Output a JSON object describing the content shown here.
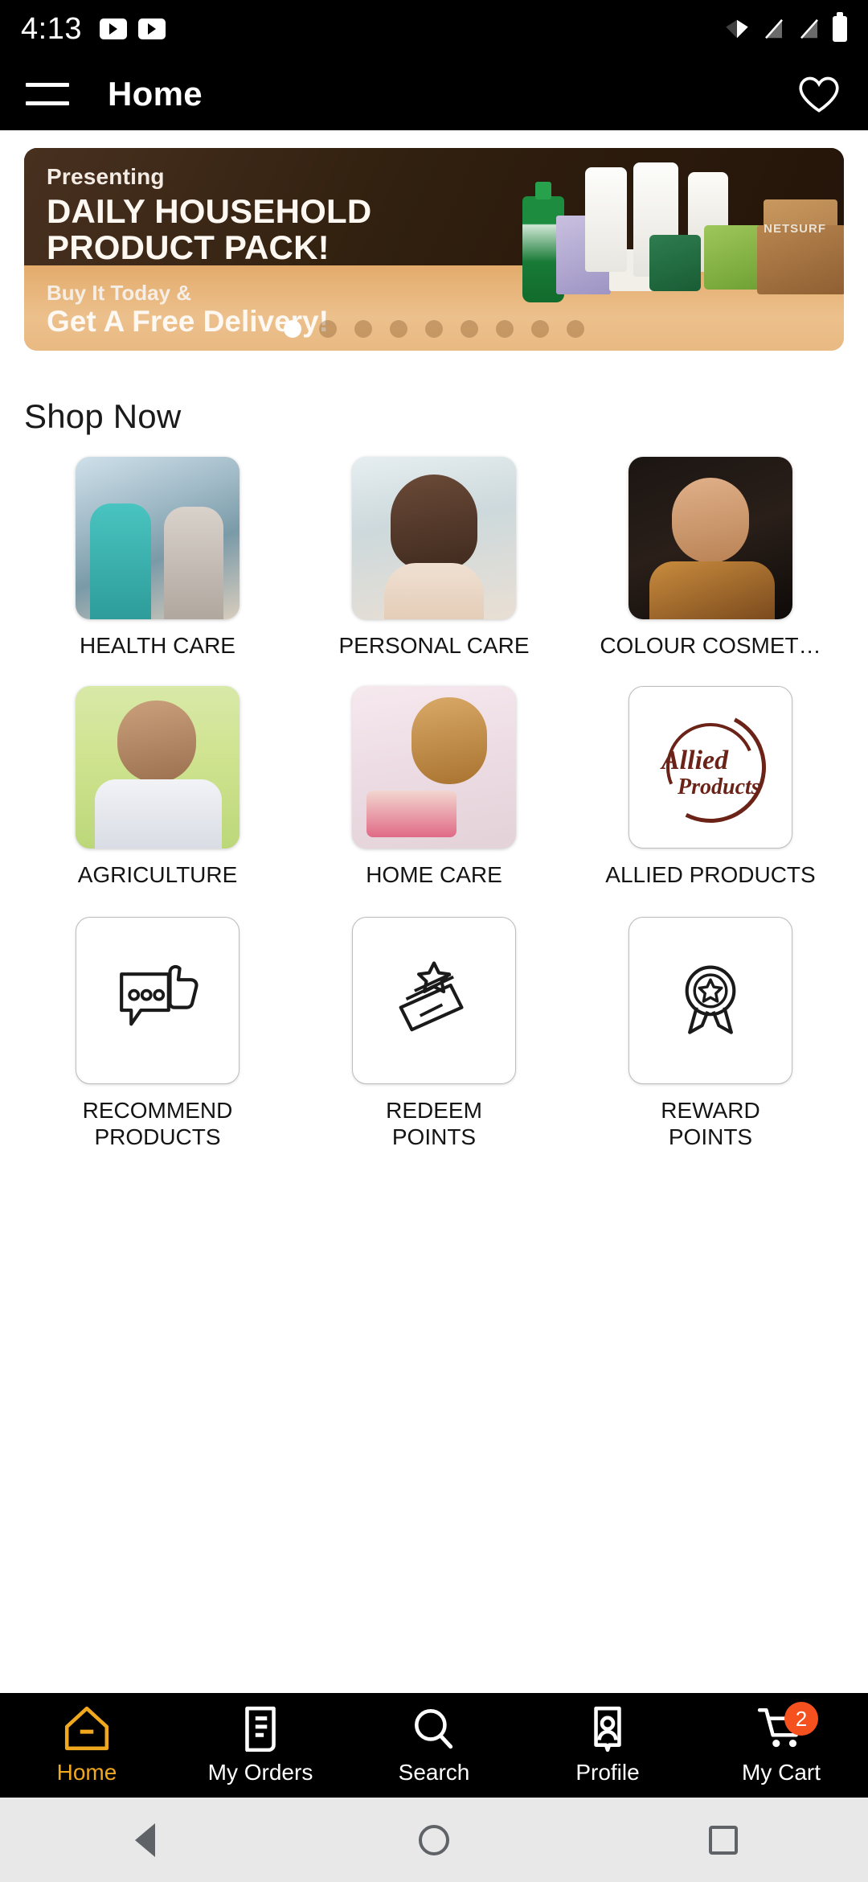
{
  "status_bar": {
    "time": "4:13",
    "icons": [
      "youtube-icon",
      "youtube-icon",
      "wifi-icon",
      "signal-off-icon",
      "signal-off-icon",
      "battery-icon"
    ]
  },
  "app_bar": {
    "menu_icon": "hamburger-menu-icon",
    "title": "Home",
    "favorite_icon": "heart-icon"
  },
  "banner": {
    "presenting": "Presenting",
    "title_line1": "DAILY HOUSEHOLD",
    "title_line2": "PRODUCT PACK!",
    "sub_line1": "Buy It Today &",
    "sub_line2": "Get A Free Delivery!",
    "brand": "NETSURF",
    "dots_total": 9,
    "active_dot": 1
  },
  "section": {
    "shop_now_title": "Shop Now"
  },
  "categories": [
    {
      "label": "HEALTH CARE",
      "icon": "health-care-photo"
    },
    {
      "label": "PERSONAL CARE",
      "icon": "personal-care-photo"
    },
    {
      "label": "COLOUR COSMET…",
      "icon": "colour-cosmetics-photo"
    },
    {
      "label": "AGRICULTURE",
      "icon": "agriculture-photo"
    },
    {
      "label": "HOME CARE",
      "icon": "home-care-photo"
    },
    {
      "label": "ALLIED PRODUCTS",
      "icon": "allied-products-logo"
    },
    {
      "label": "RECOMMEND PRODUCTS",
      "icon": "thumbs-up-chat-icon"
    },
    {
      "label": "REDEEM POINTS",
      "icon": "cards-star-icon"
    },
    {
      "label": "REWARD POINTS",
      "icon": "award-ribbon-icon"
    }
  ],
  "bottom_nav": {
    "active_color": "#f0a81e",
    "badge_color": "#f4511e",
    "items": [
      {
        "label": "Home",
        "icon": "home-icon",
        "active": true,
        "badge": ""
      },
      {
        "label": "My Orders",
        "icon": "orders-icon",
        "active": false,
        "badge": ""
      },
      {
        "label": "Search",
        "icon": "search-icon",
        "active": false,
        "badge": ""
      },
      {
        "label": "Profile",
        "icon": "profile-icon",
        "active": false,
        "badge": ""
      },
      {
        "label": "My Cart",
        "icon": "cart-icon",
        "active": false,
        "badge": "2"
      }
    ]
  },
  "android_nav": {
    "back": "back-triangle-icon",
    "home": "home-circle-icon",
    "recents": "recents-square-icon"
  }
}
